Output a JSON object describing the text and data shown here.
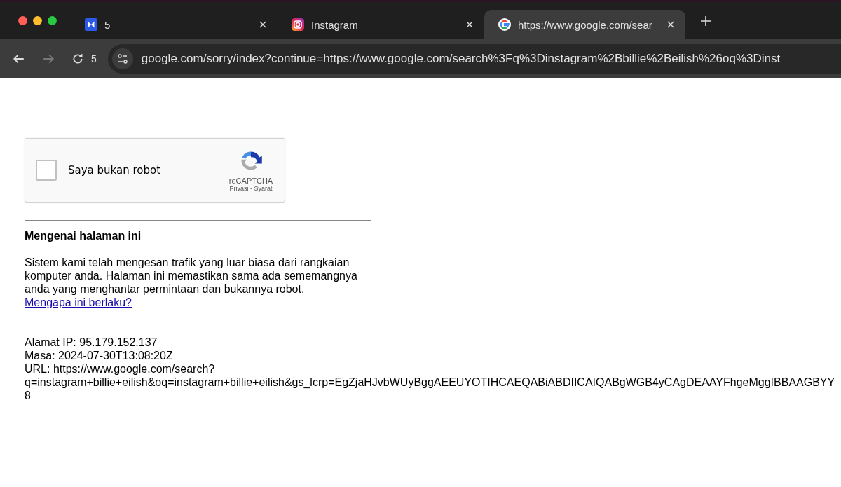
{
  "tabs": [
    {
      "kind": "app",
      "title": "5",
      "selected": false
    },
    {
      "kind": "instagram",
      "title": "Instagram",
      "selected": false
    },
    {
      "kind": "google",
      "title": "https://www.google.com/sear",
      "selected": true
    }
  ],
  "toolbar": {
    "tab_count": "5",
    "address": "google.com/sorry/index?continue=https://www.google.com/search%3Fq%3Dinstagram%2Bbillie%2Beilish%26oq%3Dinst"
  },
  "captcha": {
    "label": "Saya bukan robot",
    "checked": false,
    "brand": "reCAPTCHA",
    "privacy": "Privasi",
    "separator": "-",
    "terms": "Syarat"
  },
  "about": {
    "heading": "Mengenai halaman ini",
    "text": "Sistem kami telah mengesan trafik yang luar biasa dari rangkaian komputer anda. Halaman ini memastikan sama ada sememangnya anda yang menghantar permintaan dan bukannya robot.",
    "link": "Mengapa ini berlaku?"
  },
  "info": [
    "Alamat IP: 95.179.152.137",
    "Masa: 2024-07-30T13:08:20Z",
    "URL: https://www.google.com/search?",
    "q=instagram+billie+eilish&oq=instagram+billie+eilish&gs_lcrp=EgZjaHJvbWUyBggAEEUYOTIHCAEQABiABDIICAIQABgWGB4yCAgDEAAYFhgeMggIBBAAGBYY",
    "8"
  ]
}
